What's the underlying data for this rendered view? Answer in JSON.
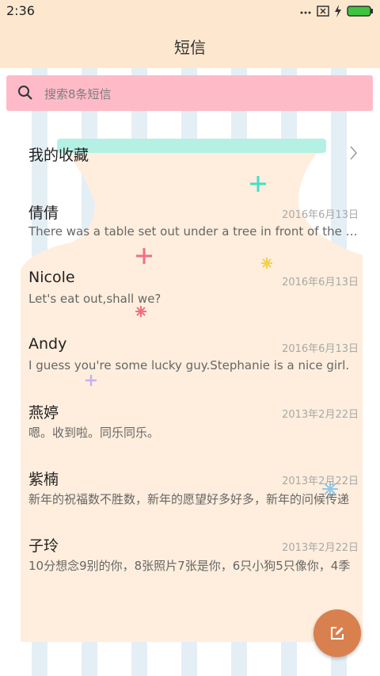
{
  "status_bar": {
    "time": "2:36"
  },
  "header": {
    "title": "短信"
  },
  "search": {
    "placeholder": "搜索8条短信"
  },
  "favorites": {
    "label": "我的收藏"
  },
  "conversations": [
    {
      "name": "倩倩",
      "date": "2016年6月13日",
      "preview": "There was a table set out under a tree in front of the house"
    },
    {
      "name": "Nicole",
      "date": "2016年6月13日",
      "preview": "Let's eat out,shall we?"
    },
    {
      "name": "Andy",
      "date": "2016年6月13日",
      "preview": "I guess you're some lucky guy.Stephanie is a nice girl."
    },
    {
      "name": "燕婷",
      "date": "2013年2月22日",
      "preview": "嗯。收到啦。同乐同乐。"
    },
    {
      "name": "紫楠",
      "date": "2013年2月22日",
      "preview": "新年的祝福数不胜数，新年的愿望好多好多，新年的问候传递"
    },
    {
      "name": "子玲",
      "date": "2013年2月22日",
      "preview": "10分想念9别的你，8张照片7张是你，6只小狗5只像你，4季"
    }
  ],
  "colors": {
    "app_bar": "#fde8cf",
    "search_bg": "#ffbac8",
    "fab": "#d9804f",
    "vase": "#ffeedd",
    "ribbon": "#b4f0e4"
  },
  "icons": {
    "search": "search-icon",
    "chevron": "chevron-right-icon",
    "compose": "compose-icon"
  }
}
